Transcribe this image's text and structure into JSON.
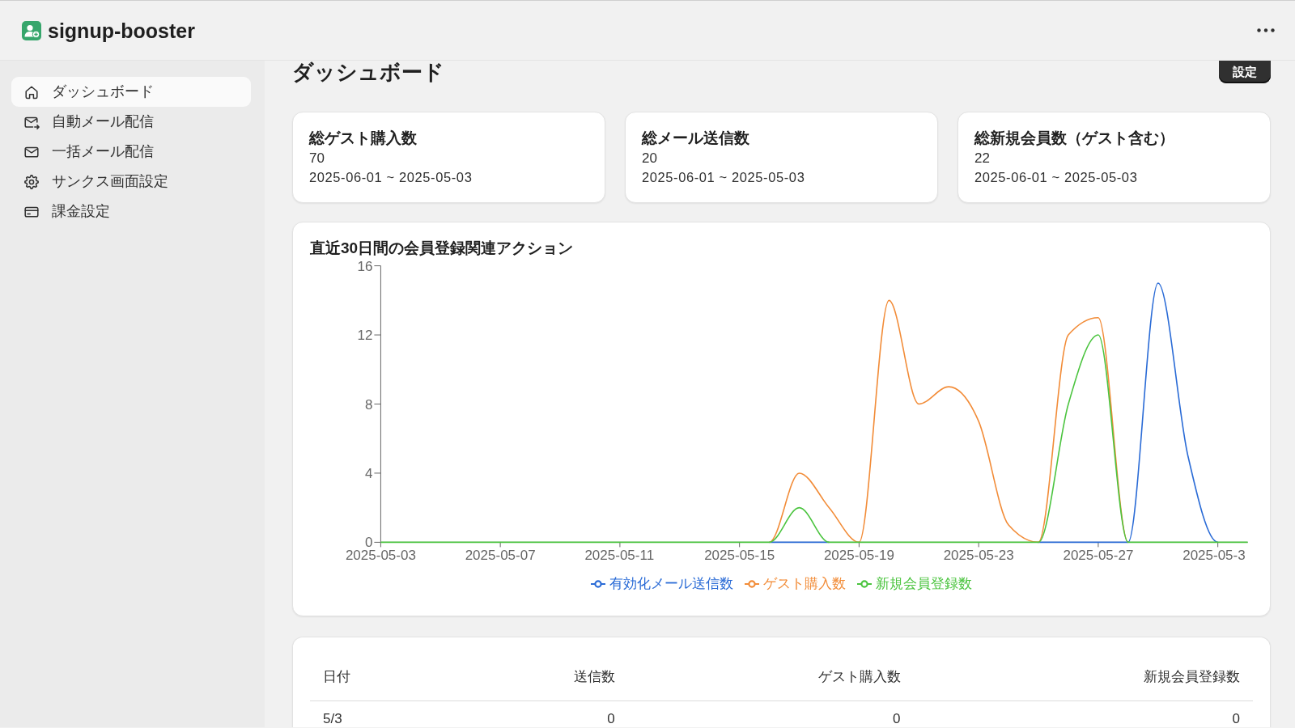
{
  "header": {
    "app_name": "signup-booster"
  },
  "sidebar": {
    "items": [
      {
        "label": "ダッシュボード",
        "selected": true
      },
      {
        "label": "自動メール配信",
        "selected": false
      },
      {
        "label": "一括メール配信",
        "selected": false
      },
      {
        "label": "サンクス画面設定",
        "selected": false
      },
      {
        "label": "課金設定",
        "selected": false
      }
    ]
  },
  "page": {
    "title": "ダッシュボード",
    "settings_button": "設定"
  },
  "stat_cards": [
    {
      "title": "総ゲスト購入数",
      "value": "70",
      "period": "2025-06-01 ~ 2025-05-03"
    },
    {
      "title": "総メール送信数",
      "value": "20",
      "period": "2025-06-01 ~ 2025-05-03"
    },
    {
      "title": "総新規会員数（ゲスト含む）",
      "value": "22",
      "period": "2025-06-01 ~ 2025-05-03"
    }
  ],
  "chart": {
    "chart_data": {
      "type": "line",
      "title": "直近30日間の会員登録関連アクション",
      "x": [
        "2025-05-03",
        "2025-05-04",
        "2025-05-05",
        "2025-05-06",
        "2025-05-07",
        "2025-05-08",
        "2025-05-09",
        "2025-05-10",
        "2025-05-11",
        "2025-05-12",
        "2025-05-13",
        "2025-05-14",
        "2025-05-15",
        "2025-05-16",
        "2025-05-17",
        "2025-05-18",
        "2025-05-19",
        "2025-05-20",
        "2025-05-21",
        "2025-05-22",
        "2025-05-23",
        "2025-05-24",
        "2025-05-25",
        "2025-05-26",
        "2025-05-27",
        "2025-05-28",
        "2025-05-29",
        "2025-05-30",
        "2025-05-31",
        "2025-06-01"
      ],
      "series": [
        {
          "name": "有効化メール送信数",
          "color": "#2a6bd6",
          "values": [
            null,
            null,
            null,
            null,
            null,
            null,
            null,
            null,
            null,
            null,
            null,
            null,
            null,
            0,
            0,
            0,
            null,
            null,
            null,
            null,
            null,
            null,
            0,
            0,
            0,
            0,
            15,
            5,
            0,
            null
          ]
        },
        {
          "name": "ゲスト購入数",
          "color": "#f28c38",
          "values": [
            null,
            null,
            null,
            null,
            null,
            null,
            null,
            null,
            null,
            null,
            null,
            null,
            null,
            0,
            4,
            2,
            0,
            14,
            8,
            9,
            7,
            1,
            0,
            12,
            13,
            0,
            null,
            null,
            null,
            null
          ]
        },
        {
          "name": "新規会員登録数",
          "color": "#4bc43f",
          "values": [
            0,
            0,
            0,
            0,
            0,
            0,
            0,
            0,
            0,
            0,
            0,
            0,
            0,
            0,
            2,
            0,
            0,
            0,
            0,
            0,
            0,
            0,
            0,
            8,
            12,
            0,
            0,
            0,
            0,
            0
          ]
        }
      ],
      "xlim": [
        "2025-05-03",
        "2025-06-01"
      ],
      "ylim": [
        0,
        16
      ],
      "yticks": [
        0,
        4,
        8,
        12,
        16
      ],
      "xticks": [
        {
          "value": "2025-05-03",
          "label": "2025-05-03"
        },
        {
          "value": "2025-05-07",
          "label": "2025-05-07"
        },
        {
          "value": "2025-05-11",
          "label": "2025-05-11"
        },
        {
          "value": "2025-05-15",
          "label": "2025-05-15"
        },
        {
          "value": "2025-05-19",
          "label": "2025-05-19"
        },
        {
          "value": "2025-05-23",
          "label": "2025-05-23"
        },
        {
          "value": "2025-05-27",
          "label": "2025-05-27"
        },
        {
          "value": "2025-05-31",
          "label": "2025-05-3"
        }
      ]
    }
  },
  "table": {
    "columns": [
      "日付",
      "送信数",
      "ゲスト購入数",
      "新規会員登録数"
    ],
    "rows": [
      [
        "5/3",
        "0",
        "0",
        "0"
      ]
    ]
  }
}
